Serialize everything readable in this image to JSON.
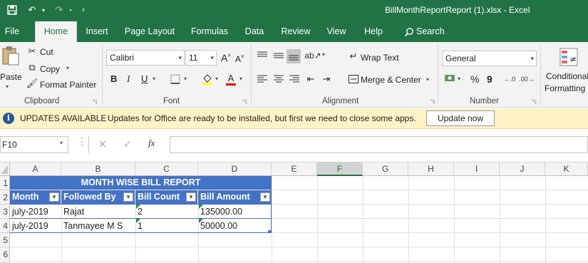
{
  "window": {
    "title": "BillMonthReportReport (1).xlsx  -  Excel"
  },
  "quick_access": {
    "save_icon": "save-icon",
    "undo_icon": "undo-icon",
    "redo_icon": "redo-icon",
    "customize_icon": "customize-icon"
  },
  "menu": {
    "tabs": [
      "File",
      "Home",
      "Insert",
      "Page Layout",
      "Formulas",
      "Data",
      "Review",
      "View",
      "Help"
    ],
    "active": "Home",
    "search_label": "Search"
  },
  "ribbon": {
    "clipboard": {
      "paste": "Paste",
      "cut": "Cut",
      "copy": "Copy",
      "format_painter": "Format Painter",
      "label": "Clipboard"
    },
    "font": {
      "name": "Calibri",
      "size": "11",
      "bold": "B",
      "italic": "I",
      "underline": "U",
      "grow": "A",
      "shrink": "A",
      "label": "Font"
    },
    "alignment": {
      "wrap_text": "Wrap Text",
      "merge_center": "Merge & Center",
      "label": "Alignment"
    },
    "number": {
      "format": "General",
      "percent": "%",
      "comma": "9",
      "label": "Number"
    },
    "styles": {
      "conditional_line1": "Conditional",
      "conditional_line2": "Formatting"
    }
  },
  "infobar": {
    "heading": "UPDATES AVAILABLE",
    "message": "Updates for Office are ready to be installed, but first we need to close some apps.",
    "button": "Update now"
  },
  "formula_bar": {
    "name_box": "F10",
    "fx_symbol": "fx",
    "content": ""
  },
  "sheet": {
    "columns": [
      "A",
      "B",
      "C",
      "D",
      "E",
      "F",
      "G",
      "H",
      "I",
      "J",
      "K"
    ],
    "selected_column": "F",
    "rows": [
      "1",
      "2",
      "3",
      "4",
      "5",
      "6"
    ],
    "report_title": "MONTH WISE BILL REPORT",
    "headers": [
      "Month",
      "Followed By",
      "Bill Count",
      "Bill Amount"
    ],
    "data": [
      [
        "july-2019",
        "Rajat",
        "2",
        "135000.00"
      ],
      [
        "july-2019",
        "Tanmayee M S",
        "1",
        "50000.00"
      ]
    ],
    "table_color": "#4472c4"
  },
  "colors": {
    "brand": "#217346",
    "infobar_bg": "#fdf3c7"
  }
}
